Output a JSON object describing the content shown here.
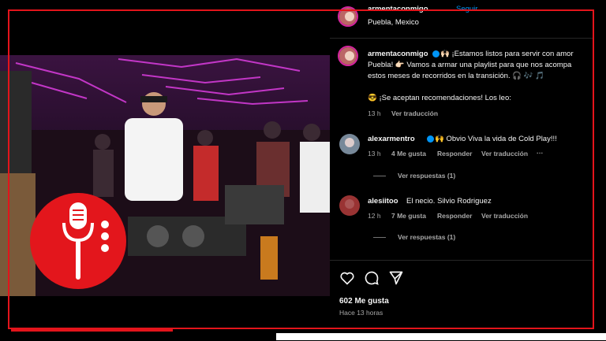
{
  "header": {
    "username": "armentaconmigo",
    "follow": "Seguir",
    "location": "Puebla, Mexico"
  },
  "caption": {
    "username": "armentaconmigo",
    "line1": "🙌🏻 ¡Estamos listos para servir con amor",
    "line2": "Puebla! 👉🏻 Vamos a armar una playlist para que nos acompa",
    "line3": "estos meses de recorridos en la transición. 🎧 🎶 🎵",
    "line4": "😎 ¡Se aceptan recomendaciones! Los leo:",
    "time": "13 h",
    "translate": "Ver traducción"
  },
  "comments": [
    {
      "username": "alexarmentro",
      "text": "🙌 Obvio Viva la vida de Cold Play!!!",
      "time": "13 h",
      "likes": "4 Me gusta",
      "reply": "Responder",
      "translate": "Ver traducción",
      "more": "···",
      "replies": "Ver respuestas (1)"
    },
    {
      "username": "alesiitoo",
      "text": "El necio. Silvio Rodriguez",
      "time": "12 h",
      "likes": "7 Me gusta",
      "reply": "Responder",
      "translate": "Ver traducción",
      "replies": "Ver respuestas (1)"
    }
  ],
  "footer": {
    "likes": "602 Me gusta",
    "time": "Hace 13 horas"
  },
  "colors": {
    "accent_red": "#e3141b",
    "verified_blue": "#0095f6",
    "background": "#000000"
  },
  "icons": [
    "heart-icon",
    "comment-icon",
    "share-icon",
    "microphone-icon"
  ]
}
